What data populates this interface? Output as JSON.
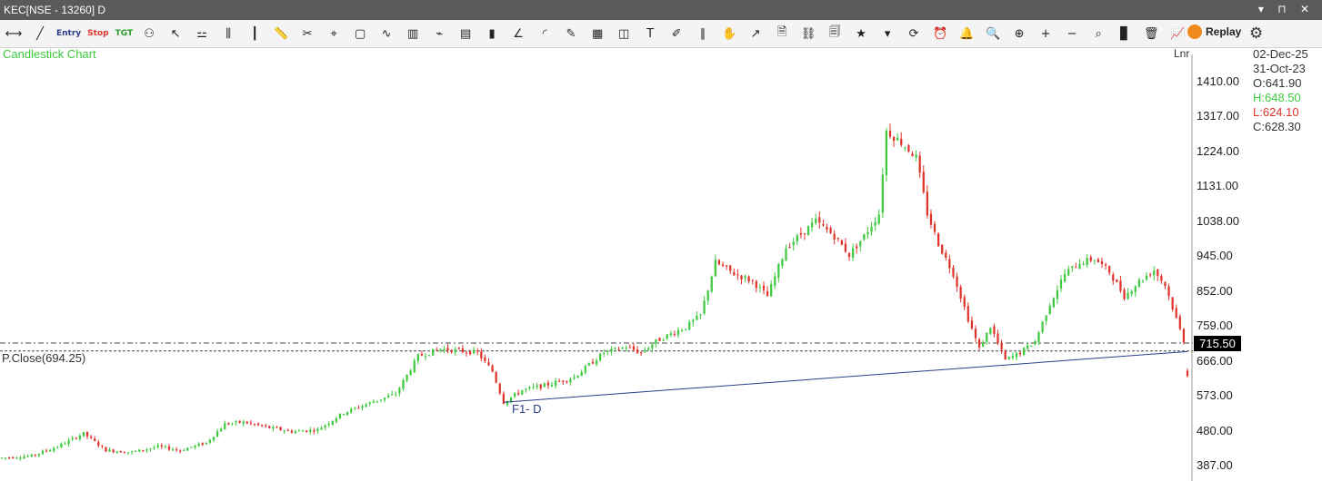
{
  "window": {
    "title": "KEC[NSE - 13260] D",
    "controls": "▾ ⊓ ✕"
  },
  "toolbar": {
    "entry": "Entry",
    "stop": "Stop",
    "tgt": "TGT",
    "replay": "Replay",
    "icons": [
      "line-icon",
      "trendline-icon",
      "entry-icon",
      "stop-icon",
      "target-icon",
      "indicator-icon",
      "pointer-icon",
      "candle-icon",
      "bars-icon",
      "ohlc-icon",
      "ruler-icon",
      "scissor-icon",
      "crosshair-icon",
      "rectangle-icon",
      "wave-icon",
      "histogram-icon",
      "zigzag-icon",
      "volume-icon",
      "candles-icon",
      "fan-icon",
      "arc-icon",
      "pencil-icon",
      "bars2-icon",
      "cube-icon",
      "text-icon",
      "brush-icon",
      "parallel-icon",
      "hand-icon",
      "export-icon",
      "doc-icon",
      "link-icon",
      "page-icon",
      "star-icon",
      "drop-icon",
      "cycle-icon",
      "alarm-icon",
      "bell-icon",
      "zoom-icon",
      "zoom-fit-icon",
      "zoom-in-icon",
      "zoom-out-icon",
      "zoom-reset-icon",
      "bar-chart-icon",
      "delete-icon",
      "graph-icon",
      "replay-icon",
      "gear-icon"
    ]
  },
  "header": {
    "chart_title": "Candlestick Chart",
    "lnr": "Lnr"
  },
  "info": {
    "date_end": "02-Dec-25",
    "date_start": "31-Oct-23",
    "open": "O:641.90",
    "high": "H:648.50",
    "low": "L:624.10",
    "close": "C:628.30"
  },
  "labels": {
    "pclose": "P.Close(694.25)",
    "fib": "F1- D",
    "last_price": "715.50"
  },
  "colors": {
    "up": "#3fc93f",
    "down": "#e0342b",
    "trendline": "#2b3f8c",
    "title_green": "#3fc93f"
  },
  "chart_data": {
    "type": "candlestick",
    "title": "Candlestick Chart",
    "date_range": [
      "31-Oct-23",
      "02-Dec-25"
    ],
    "y_ticks": [
      "1410.00",
      "1317.00",
      "1224.00",
      "1131.00",
      "1038.00",
      "945.00",
      "852.00",
      "759.00",
      "666.00",
      "573.00",
      "480.00",
      "387.00"
    ],
    "ylim": [
      375,
      1470
    ],
    "last_bar": {
      "open": 641.9,
      "high": 648.5,
      "low": 624.1,
      "close": 628.3
    },
    "previous_close": 694.25,
    "horizontal_lines": [
      715.5,
      694.25
    ],
    "trendline": {
      "label": "F1- D",
      "from_index": 135,
      "from_value": 558,
      "to_index": 319,
      "to_value": 693
    },
    "price_path": [
      [
        0,
        410
      ],
      [
        8,
        415
      ],
      [
        15,
        440
      ],
      [
        22,
        475
      ],
      [
        28,
        430
      ],
      [
        35,
        425
      ],
      [
        42,
        440
      ],
      [
        48,
        430
      ],
      [
        55,
        450
      ],
      [
        60,
        500
      ],
      [
        65,
        505
      ],
      [
        72,
        490
      ],
      [
        78,
        480
      ],
      [
        85,
        485
      ],
      [
        92,
        530
      ],
      [
        100,
        560
      ],
      [
        106,
        580
      ],
      [
        112,
        680
      ],
      [
        118,
        700
      ],
      [
        123,
        695
      ],
      [
        128,
        690
      ],
      [
        132,
        640
      ],
      [
        135,
        558
      ],
      [
        140,
        590
      ],
      [
        147,
        605
      ],
      [
        154,
        625
      ],
      [
        162,
        690
      ],
      [
        168,
        705
      ],
      [
        172,
        690
      ],
      [
        176,
        720
      ],
      [
        180,
        740
      ],
      [
        184,
        758
      ],
      [
        188,
        790
      ],
      [
        192,
        930
      ],
      [
        197,
        900
      ],
      [
        202,
        880
      ],
      [
        206,
        840
      ],
      [
        211,
        970
      ],
      [
        215,
        1005
      ],
      [
        219,
        1040
      ],
      [
        224,
        1000
      ],
      [
        228,
        950
      ],
      [
        232,
        1000
      ],
      [
        236,
        1060
      ],
      [
        238,
        1280
      ],
      [
        242,
        1250
      ],
      [
        246,
        1210
      ],
      [
        249,
        1060
      ],
      [
        252,
        980
      ],
      [
        256,
        900
      ],
      [
        260,
        780
      ],
      [
        263,
        700
      ],
      [
        266,
        760
      ],
      [
        270,
        670
      ],
      [
        274,
        690
      ],
      [
        278,
        720
      ],
      [
        282,
        820
      ],
      [
        286,
        900
      ],
      [
        290,
        930
      ],
      [
        294,
        940
      ],
      [
        298,
        905
      ],
      [
        302,
        840
      ],
      [
        306,
        880
      ],
      [
        310,
        910
      ],
      [
        313,
        870
      ],
      [
        316,
        780
      ],
      [
        319,
        694
      ]
    ]
  }
}
